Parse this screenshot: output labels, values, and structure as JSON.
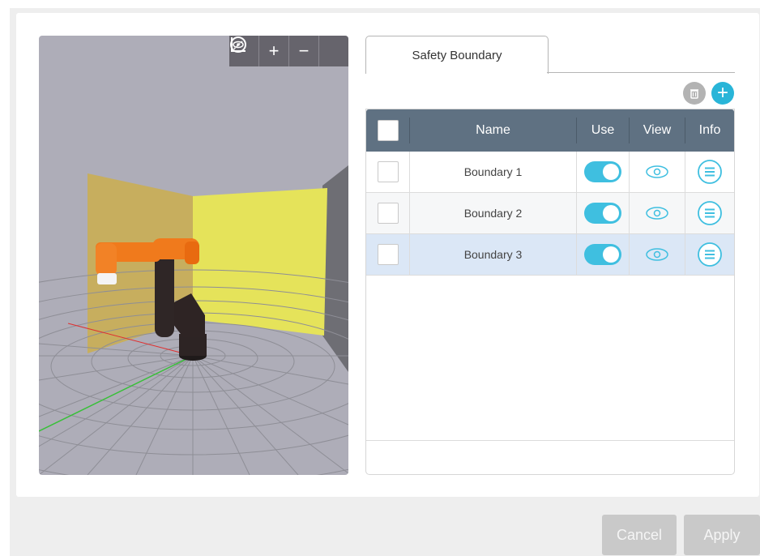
{
  "viewport": {
    "toolbar": [
      {
        "name": "axes-icon",
        "glyph": "⟀"
      },
      {
        "name": "zoom-in-icon",
        "glyph": "+"
      },
      {
        "name": "zoom-out-icon",
        "glyph": "−"
      },
      {
        "name": "view-icon",
        "glyph": "◉"
      }
    ]
  },
  "tabs": [
    {
      "label": "Safety Boundary"
    }
  ],
  "table": {
    "headers": {
      "name": "Name",
      "use": "Use",
      "view": "View",
      "info": "Info"
    },
    "rows": [
      {
        "name": "Boundary 1",
        "use": true,
        "selected": false
      },
      {
        "name": "Boundary 2",
        "use": true,
        "selected": false
      },
      {
        "name": "Boundary 3",
        "use": true,
        "selected": true
      }
    ]
  },
  "buttons": {
    "cancel": "Cancel",
    "apply": "Apply"
  },
  "colors": {
    "accent": "#29b5d8",
    "header": "#5f7182",
    "selected_row": "#dbe7f6",
    "alt_row": "#f6f7f8",
    "robot_orange": "#f07a1c"
  }
}
